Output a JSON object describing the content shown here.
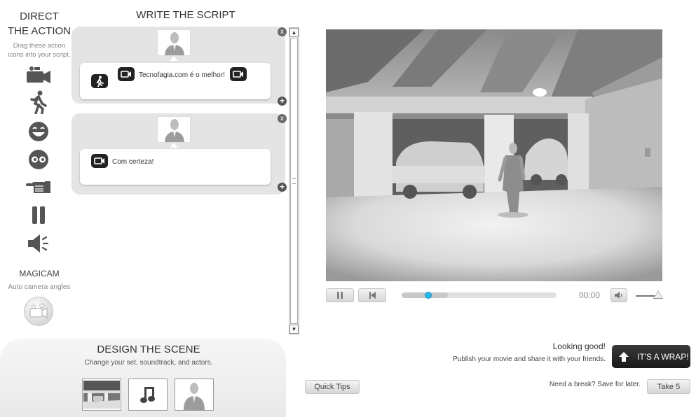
{
  "left": {
    "title_line1": "DIRECT",
    "title_line2": "THE ACTION",
    "subtitle_line1": "Drag these action",
    "subtitle_line2": "icons into your script.",
    "tools": [
      "camera-icon",
      "walk-icon",
      "happy-face-icon",
      "eyes-icon",
      "point-hand-icon",
      "pause-icon",
      "speaker-icon"
    ],
    "magicam_title": "MAGICAM",
    "magicam_subtitle": "Auto camera angles"
  },
  "script": {
    "title": "WRITE THE SCRIPT",
    "cards": [
      {
        "text": "Tecnofagia.com é o melhor!"
      },
      {
        "text": "Com certeza!"
      }
    ],
    "close_symbol": "x",
    "add_symbol": "+"
  },
  "player": {
    "time": "00:00",
    "progress_fraction": 0.17,
    "buffer_fraction": 0.3
  },
  "scene": {
    "title": "DESIGN THE SCENE",
    "subtitle": "Change your set, soundtrack, and actors."
  },
  "actions": {
    "quick_tips": "Quick Tips",
    "looking_good": "Looking good!",
    "publish_text": "Publish your movie and share it with your friends.",
    "wrap_label": "IT'S A WRAP!",
    "break_text": "Need a break? Save for later.",
    "take5_label": "Take 5"
  },
  "colors": {
    "accent": "#2bb7e6",
    "wrap_button": "#222222"
  }
}
